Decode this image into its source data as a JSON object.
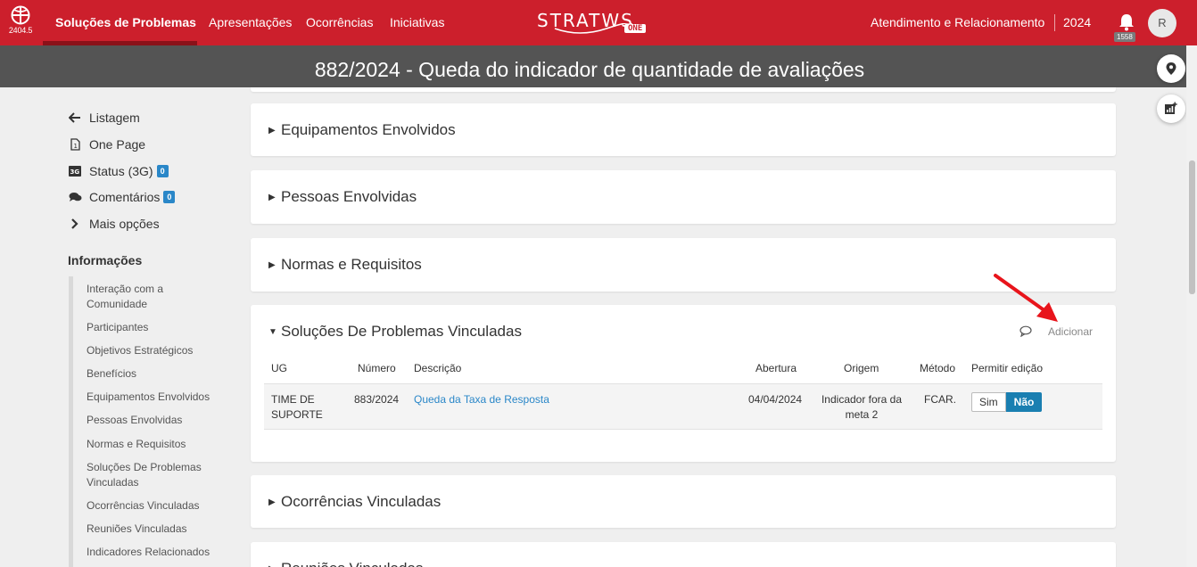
{
  "app": {
    "version": "2404.5",
    "brand_word": "STRATWS",
    "brand_suffix": "ONE",
    "nav": [
      "Soluções de Problemas",
      "Apresentações",
      "Ocorrências",
      "Iniciativas"
    ],
    "org_unit": "Atendimento e Relacionamento",
    "year": "2024",
    "notifications": "1558",
    "avatar_initial": "R"
  },
  "page": {
    "title": "882/2024 - Queda do indicador de quantidade de avaliações"
  },
  "sidebar": {
    "links": [
      {
        "label": "Listagem",
        "icon": "arrow-left-icon"
      },
      {
        "label": "One Page",
        "icon": "document-icon"
      },
      {
        "label": "Status (3G)",
        "icon": "3g-icon",
        "badge": "0"
      },
      {
        "label": "Comentários",
        "icon": "comments-icon",
        "badge": "0"
      },
      {
        "label": "Mais opções",
        "icon": "chevron-right-icon"
      }
    ],
    "info_heading": "Informações",
    "info_items": [
      "Interação com a Comunidade",
      "Participantes",
      "Objetivos Estratégicos",
      "Benefícios",
      "Equipamentos Envolvidos",
      "Pessoas Envolvidas",
      "Normas e Requisitos",
      "Soluções De Problemas Vinculadas",
      "Ocorrências Vinculadas",
      "Reuniões Vinculadas",
      "Indicadores Relacionados"
    ]
  },
  "sections": {
    "equipamentos": "Equipamentos Envolvidos",
    "pessoas": "Pessoas Envolvidas",
    "normas": "Normas e Requisitos",
    "solucoes": "Soluções De Problemas Vinculadas",
    "ocorrencias": "Ocorrências Vinculadas",
    "reunioes": "Reuniões Vinculadas"
  },
  "solucoes_table": {
    "add_label": "Adicionar",
    "headers": [
      "UG",
      "Número",
      "Descrição",
      "Abertura",
      "Origem",
      "Método",
      "Permitir edição"
    ],
    "rows": [
      {
        "ug": "TIME DE SUPORTE",
        "numero": "883/2024",
        "descricao": "Queda da Taxa de Resposta",
        "abertura": "04/04/2024",
        "origem": "Indicador fora da meta 2",
        "metodo": "FCAR.",
        "toggle_yes": "Sim",
        "toggle_no": "Não",
        "selected": "Não"
      }
    ]
  },
  "annotation": {
    "color": "#e8141b"
  }
}
